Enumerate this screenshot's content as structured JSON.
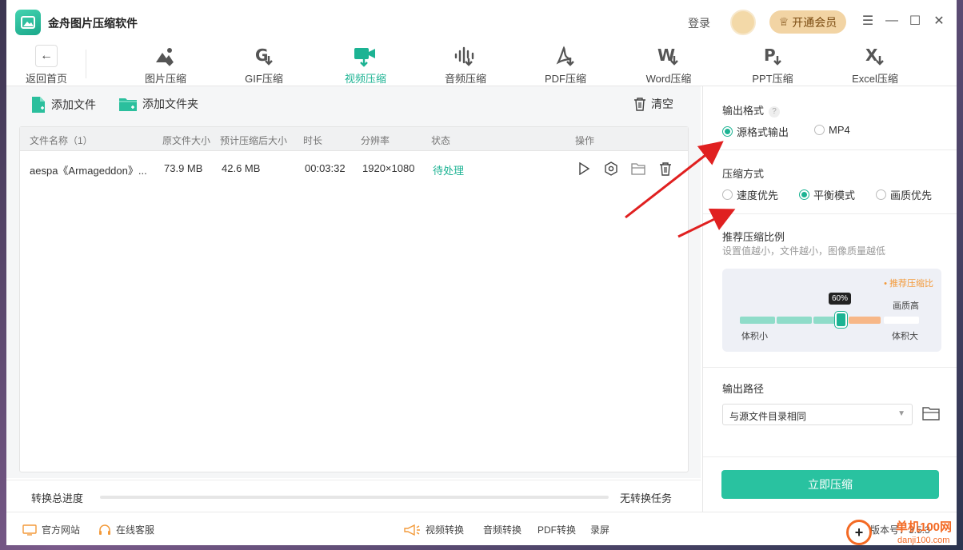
{
  "window": {
    "title": "金舟图片压缩软件",
    "login": "登录",
    "vip_label": "开通会员"
  },
  "toolbar": {
    "back_label": "返回首页",
    "tools": [
      {
        "label": "图片压缩",
        "icon": "image-icon",
        "active": false
      },
      {
        "label": "GIF压缩",
        "icon": "gif-icon",
        "active": false
      },
      {
        "label": "视频压缩",
        "icon": "video-icon",
        "active": true
      },
      {
        "label": "音频压缩",
        "icon": "audio-icon",
        "active": false
      },
      {
        "label": "PDF压缩",
        "icon": "pdf-icon",
        "active": false
      },
      {
        "label": "Word压缩",
        "icon": "word-icon",
        "active": false
      },
      {
        "label": "PPT压缩",
        "icon": "ppt-icon",
        "active": false
      },
      {
        "label": "Excel压缩",
        "icon": "excel-icon",
        "active": false
      }
    ]
  },
  "file_actions": {
    "add_file": "添加文件",
    "add_folder": "添加文件夹",
    "clear": "清空"
  },
  "table": {
    "headers": {
      "name": "文件名称（1）",
      "orig_size": "原文件大小",
      "est_size": "预计压缩后大小",
      "duration": "时长",
      "resolution": "分辨率",
      "status": "状态",
      "ops": "操作"
    },
    "rows": [
      {
        "name": "aespa《Armageddon》...",
        "orig_size": "73.9 MB",
        "est_size": "42.6 MB",
        "duration": "00:03:32",
        "resolution": "1920×1080",
        "status": "待处理"
      }
    ]
  },
  "progress": {
    "label": "转换总进度",
    "value": 0,
    "status": "无转换任务"
  },
  "settings": {
    "output_format": {
      "title": "输出格式",
      "options": [
        "源格式输出",
        "MP4"
      ],
      "selected": 0
    },
    "compress_mode": {
      "title": "压缩方式",
      "options": [
        "速度优先",
        "平衡模式",
        "画质优先"
      ],
      "selected": 1
    },
    "ratio": {
      "title": "推荐压缩比例",
      "desc": "设置值越小，文件越小，图像质量越低",
      "recommend": "• 推荐压缩比",
      "value_label": "60%",
      "value": 0.6,
      "high_quality": "画质高",
      "small": "体积小",
      "large": "体积大"
    },
    "output_path": {
      "title": "输出路径",
      "value": "与源文件目录相同"
    },
    "start_button": "立即压缩"
  },
  "footer": {
    "website": "官方网站",
    "support": "在线客服",
    "links": [
      "视频转换",
      "音频转换",
      "PDF转换",
      "录屏"
    ],
    "version": "版本号：3.5.3"
  },
  "watermark": {
    "text1": "单机100网",
    "text2": "danji100.com"
  },
  "colors": {
    "accent": "#1cb393",
    "button": "#29c2a0",
    "vip": "#f2d4a4",
    "arrow": "#e02020"
  }
}
